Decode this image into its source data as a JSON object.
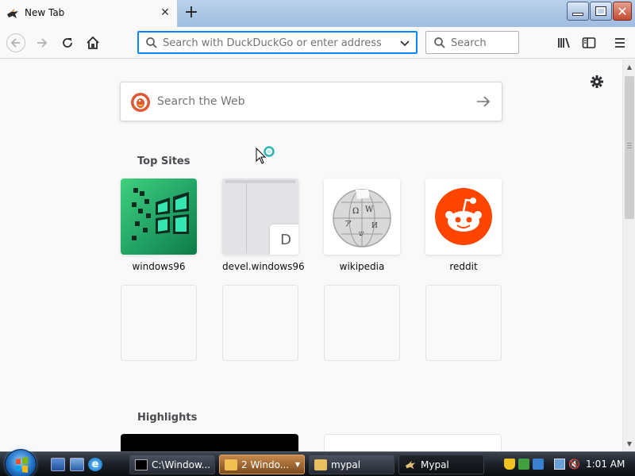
{
  "tab": {
    "title": "New Tab"
  },
  "navbar": {
    "url_placeholder": "Search with DuckDuckGo or enter address",
    "search_placeholder": "Search"
  },
  "content": {
    "web_search_placeholder": "Search the Web",
    "top_sites_title": "Top Sites",
    "highlights_title": "Highlights",
    "top_sites": [
      {
        "label": "windows96"
      },
      {
        "label": "devel.windows96",
        "badge": "D"
      },
      {
        "label": "wikipedia"
      },
      {
        "label": "reddit"
      }
    ]
  },
  "taskbar": {
    "tasks": [
      {
        "label": "C:\\Window..."
      },
      {
        "label": "2 Windo..."
      },
      {
        "label": "mypal"
      },
      {
        "label": "Mypal"
      }
    ],
    "clock": "1:01 AM"
  },
  "colors": {
    "accent": "#0a84ff",
    "reddit": "#ff4500",
    "windows96_tile": "#2fbd6e"
  }
}
